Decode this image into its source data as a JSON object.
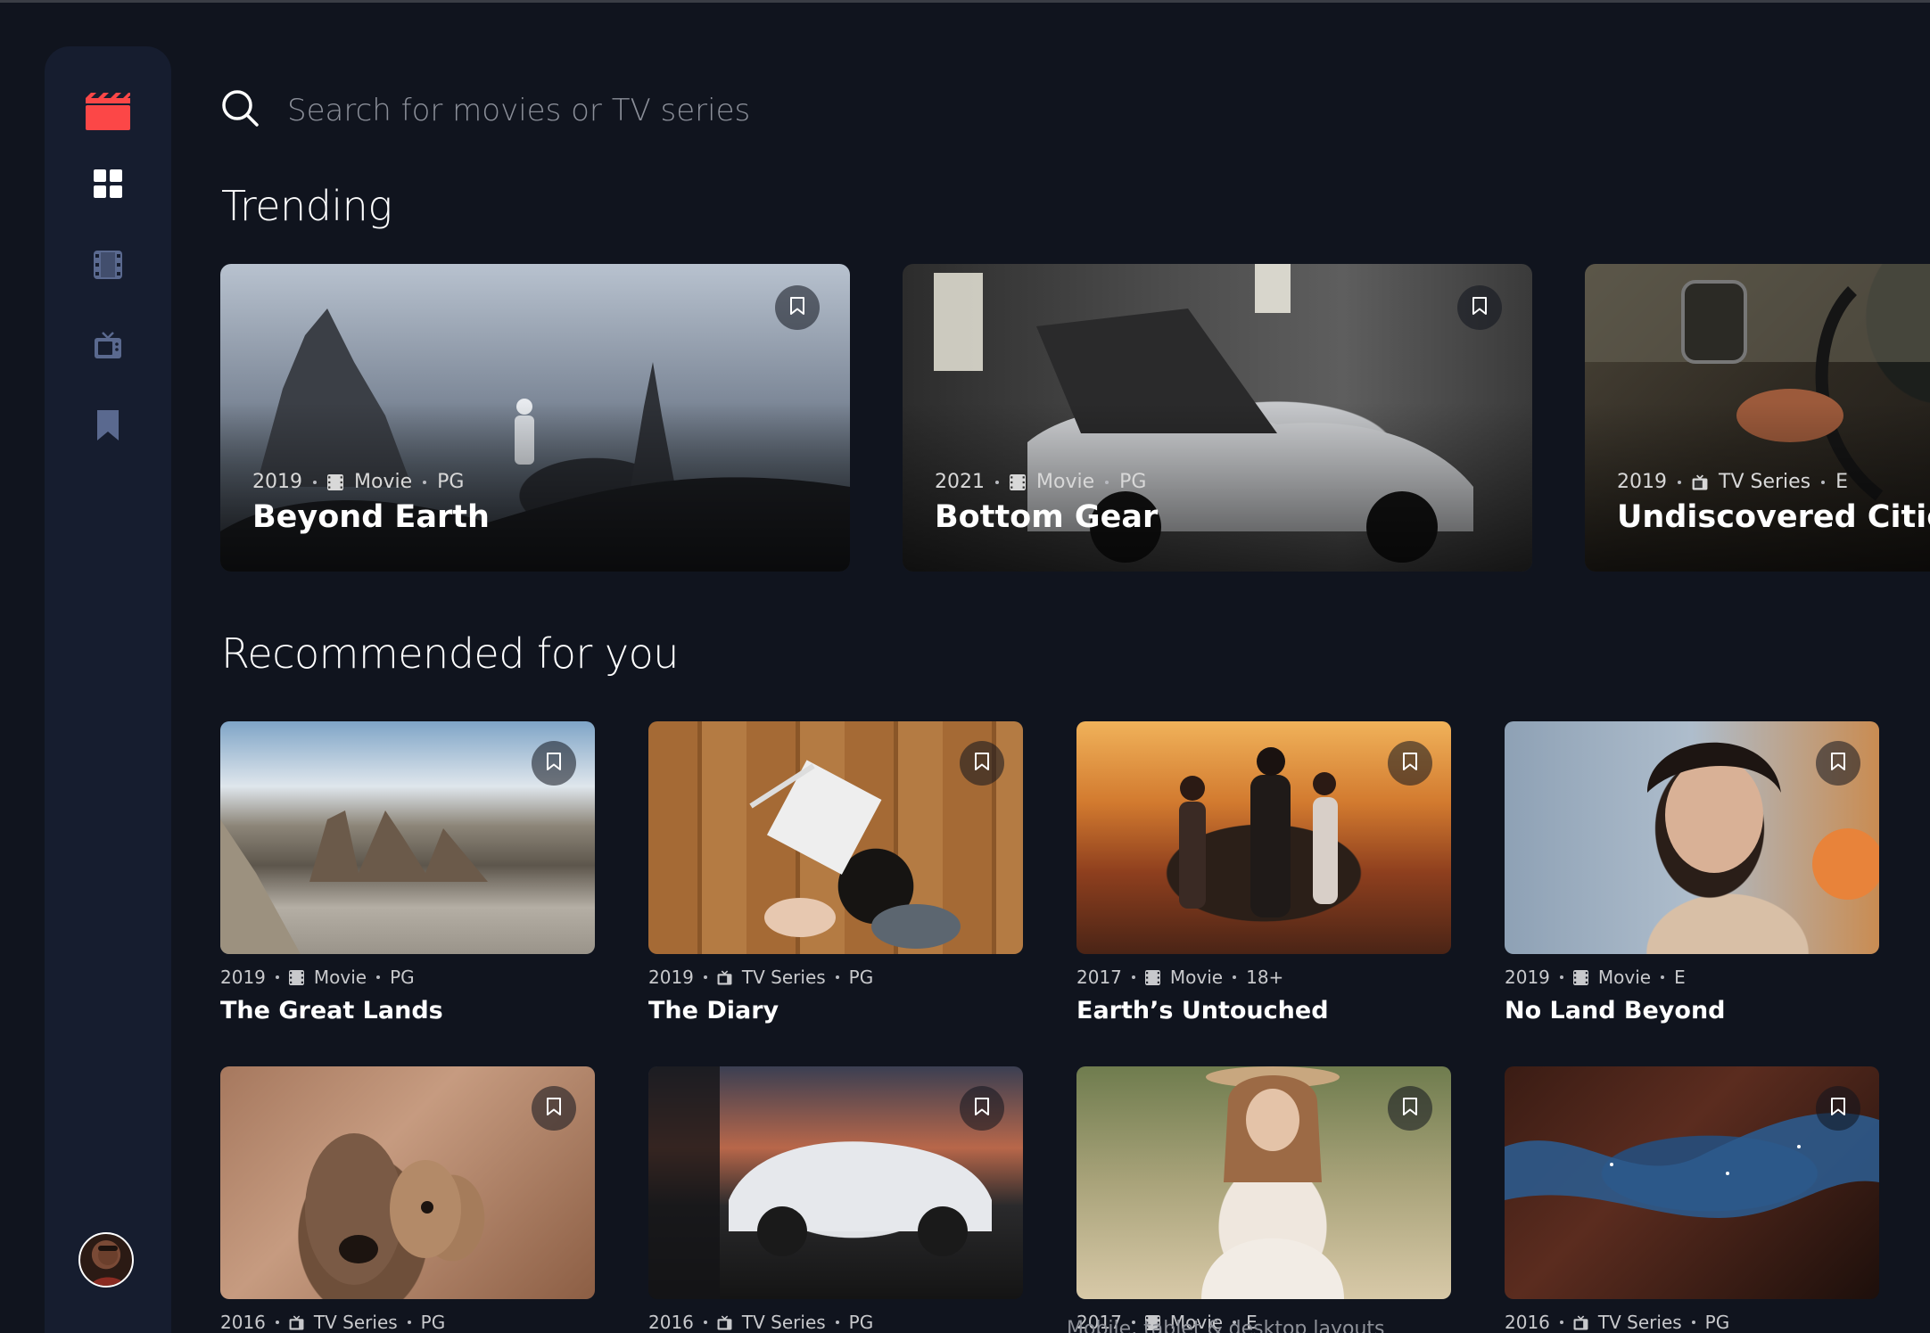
{
  "app": {
    "accent": "#fc4747",
    "background": "#10141e",
    "sidebar_bg": "#161d2f"
  },
  "sidebar": {
    "logo": "clapperboard-icon",
    "items": [
      {
        "name": "home",
        "icon": "grid-icon",
        "active": true
      },
      {
        "name": "movies",
        "icon": "film-icon",
        "active": false
      },
      {
        "name": "tv-series",
        "icon": "tv-icon",
        "active": false
      },
      {
        "name": "bookmarks",
        "icon": "bookmark-icon",
        "active": false
      }
    ],
    "avatar": "avatar"
  },
  "search": {
    "placeholder": "Search for movies or TV series",
    "value": ""
  },
  "trending": {
    "title": "Trending",
    "items": [
      {
        "year": "2019",
        "category": "Movie",
        "rating": "PG",
        "title": "Beyond Earth"
      },
      {
        "year": "2021",
        "category": "Movie",
        "rating": "PG",
        "title": "Bottom Gear"
      },
      {
        "year": "2019",
        "category": "TV Series",
        "rating": "E",
        "title": "Undiscovered Cities"
      }
    ]
  },
  "recommended": {
    "title": "Recommended for you",
    "items": [
      {
        "year": "2019",
        "category": "Movie",
        "rating": "PG",
        "title": "The Great Lands"
      },
      {
        "year": "2019",
        "category": "TV Series",
        "rating": "PG",
        "title": "The Diary"
      },
      {
        "year": "2017",
        "category": "Movie",
        "rating": "18+",
        "title": "Earth’s Untouched"
      },
      {
        "year": "2019",
        "category": "Movie",
        "rating": "E",
        "title": "No Land Beyond"
      },
      {
        "year": "2016",
        "category": "TV Series",
        "rating": "PG",
        "title": ""
      },
      {
        "year": "2016",
        "category": "TV Series",
        "rating": "PG",
        "title": ""
      },
      {
        "year": "2017",
        "category": "Movie",
        "rating": "E",
        "title": ""
      },
      {
        "year": "2016",
        "category": "TV Series",
        "rating": "PG",
        "title": ""
      }
    ]
  },
  "footer_note": "Mobile, tablet & desktop layouts"
}
